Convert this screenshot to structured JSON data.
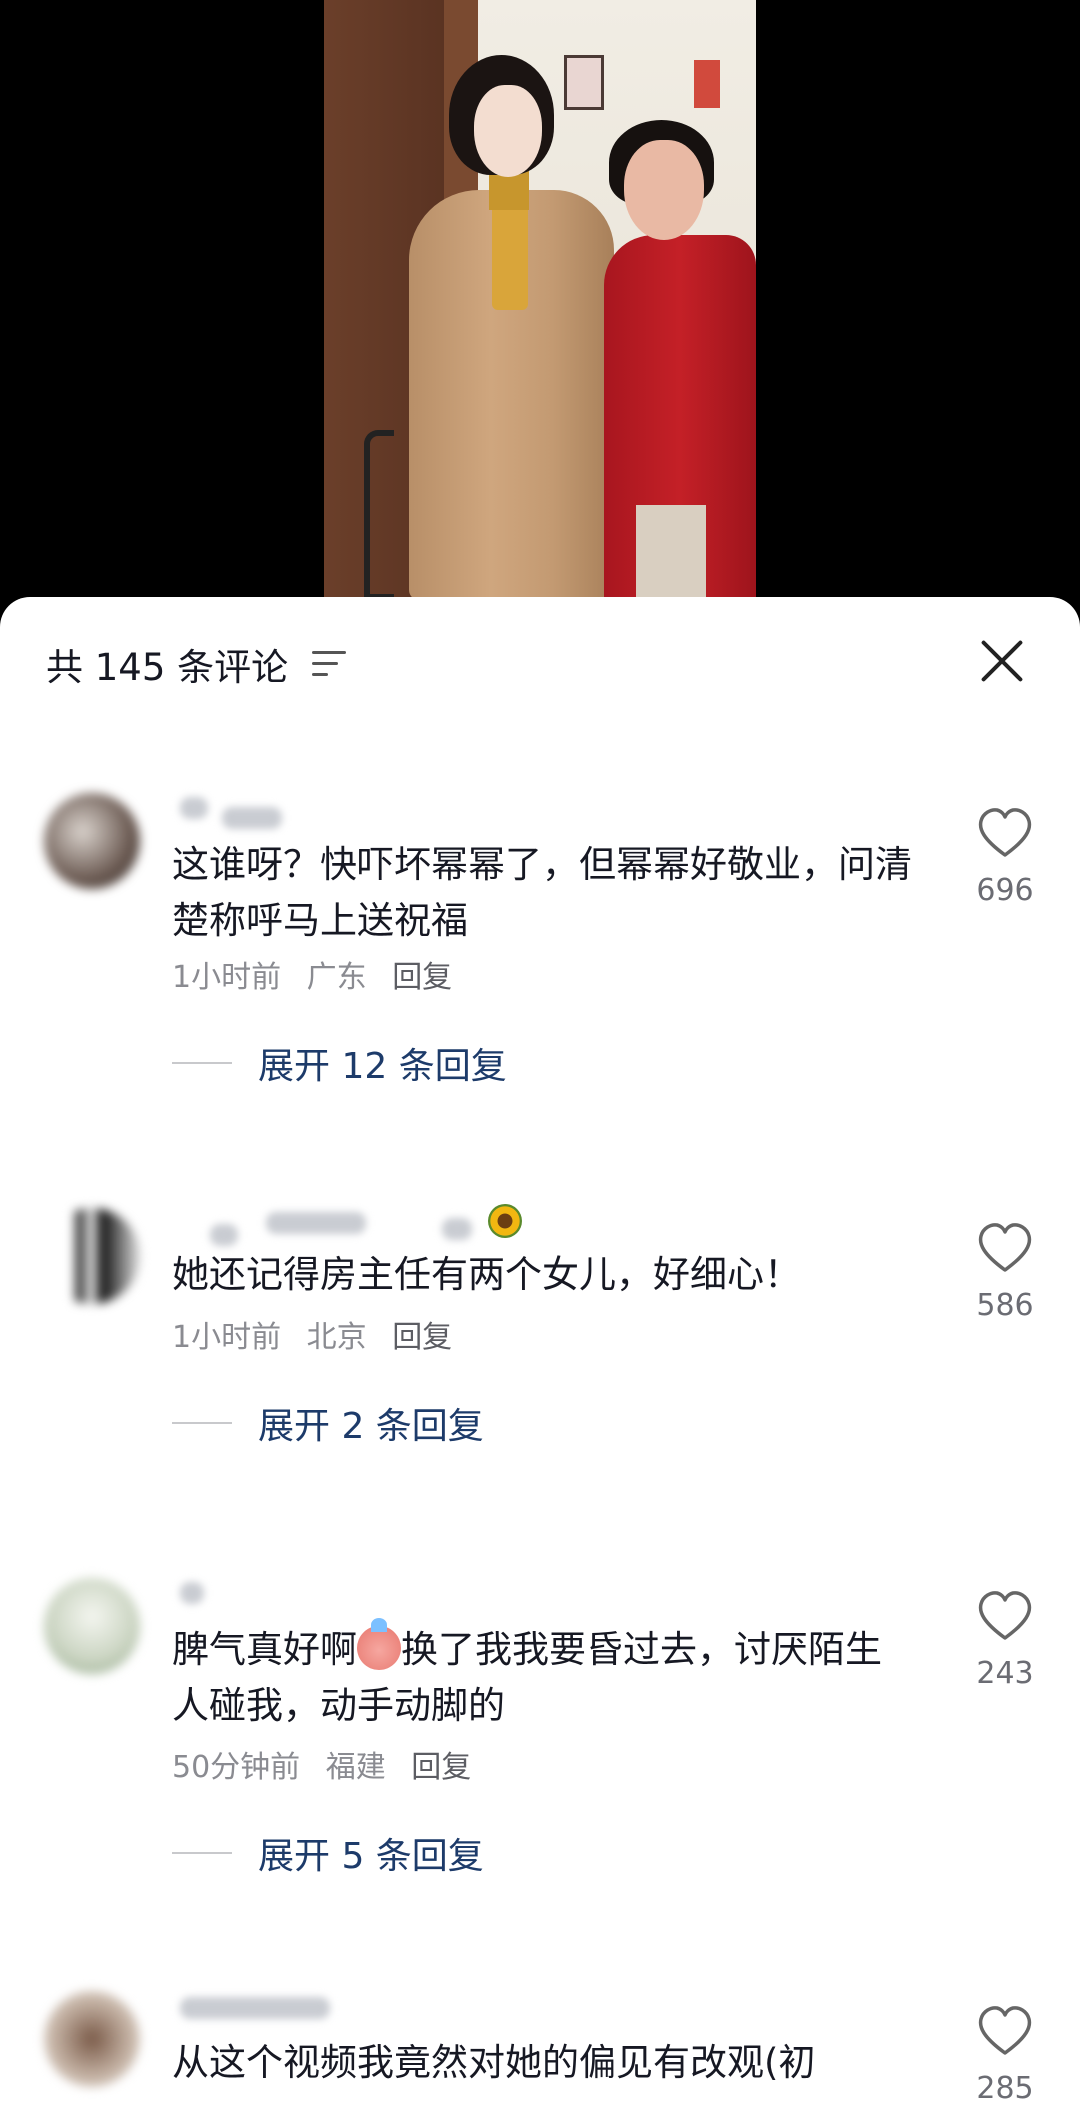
{
  "header": {
    "comment_count": "共 145 条评论"
  },
  "comments": [
    {
      "text": "这谁呀？快吓坏幂幂了，但幂幂好敬业，问清楚称呼马上送祝福",
      "time": "1小时前",
      "location": "广东",
      "reply_label": "回复",
      "expand_label": "展开 12 条回复",
      "likes": "696"
    },
    {
      "text": "她还记得房主任有两个女儿，好细心！",
      "time": "1小时前",
      "location": "北京",
      "reply_label": "回复",
      "expand_label": "展开 2 条回复",
      "likes": "586"
    },
    {
      "text_before_emoji": "脾气真好啊",
      "text_after_emoji": "换了我我要昏过去，讨厌陌生人碰我，动手动脚的",
      "time": "50分钟前",
      "location": "福建",
      "reply_label": "回复",
      "expand_label": "展开 5 条回复",
      "likes": "243"
    },
    {
      "text": "从这个视频我竟然对她的偏见有改观(初",
      "likes": "285"
    }
  ],
  "icons": {
    "sort": "sort-icon",
    "close": "close-icon",
    "like": "heart-icon"
  },
  "colors": {
    "expand_link": "#1d3b6a",
    "meta_text": "#8a8b91",
    "body_text": "#161823"
  }
}
